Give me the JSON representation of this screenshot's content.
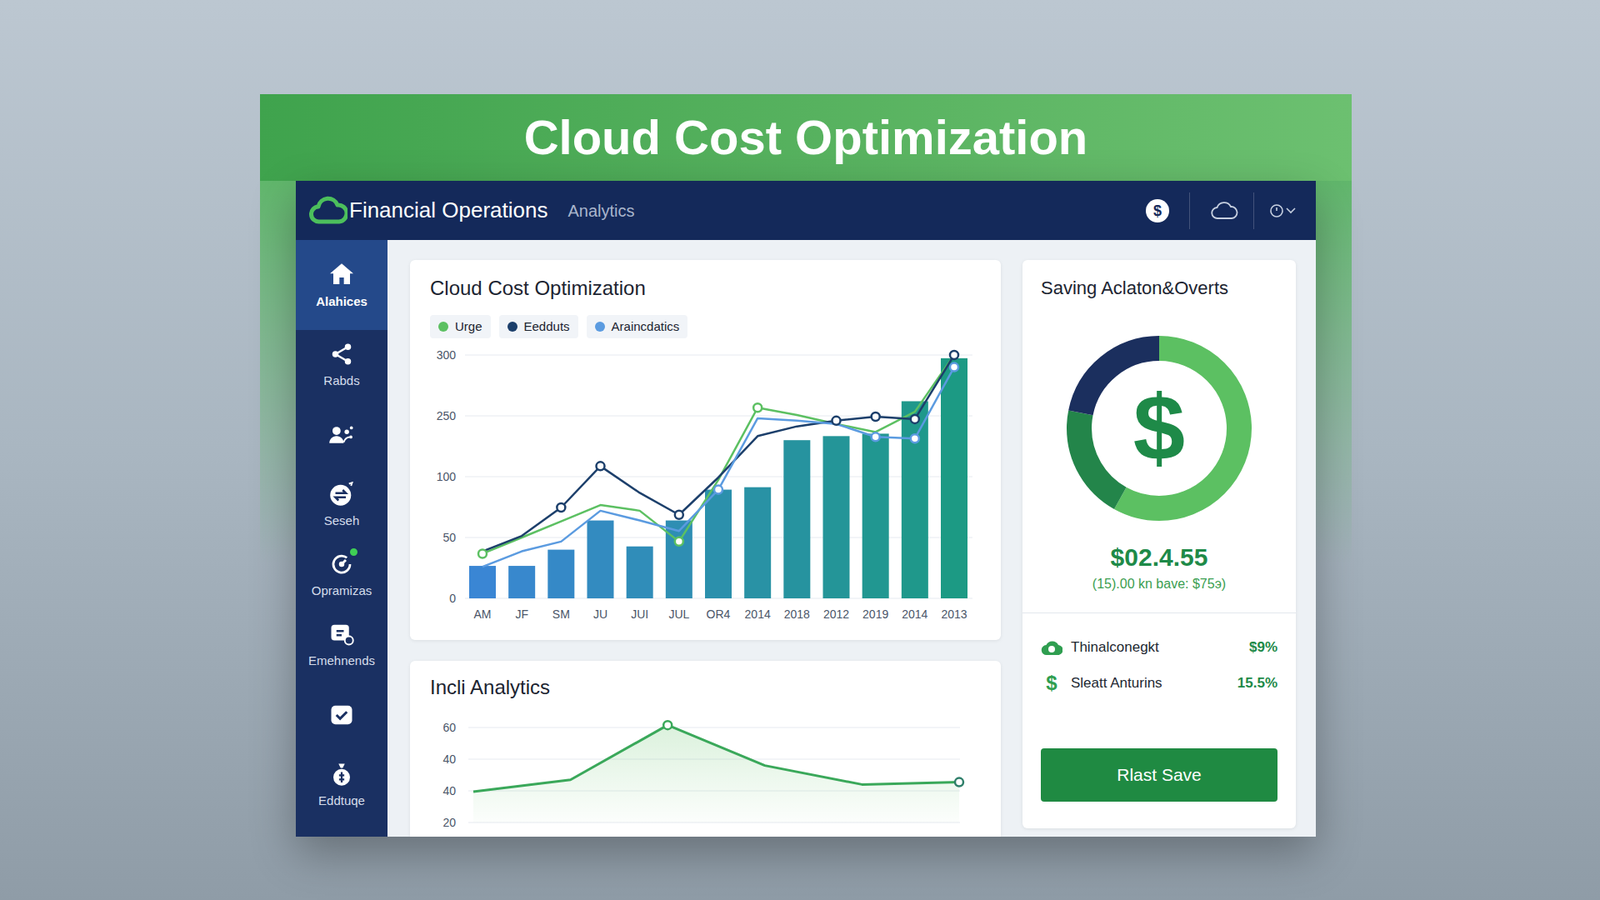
{
  "banner": {
    "title": "Cloud Cost Optimization"
  },
  "header": {
    "app_name": "Financial Operations",
    "section": "Analytics",
    "currency_icon": "$"
  },
  "sidebar": {
    "items": [
      {
        "label": "Alahices",
        "selected": true,
        "badge": false
      },
      {
        "label": "Rabds",
        "selected": false,
        "badge": false
      },
      {
        "selected": false,
        "badge": false
      },
      {
        "label": "Seseh",
        "selected": false,
        "badge": false
      },
      {
        "label": "Opramizas",
        "selected": false,
        "badge": true
      },
      {
        "label": "Emehnends",
        "selected": false,
        "badge": false
      },
      {
        "selected": false,
        "badge": false
      },
      {
        "label": "Eddtuqe",
        "selected": false,
        "badge": false
      }
    ]
  },
  "cost_chart": {
    "title": "Cloud Cost Optimization",
    "y_axis": {
      "max": 300,
      "ticks": [
        "300",
        "250",
        "100",
        "50",
        "0"
      ]
    },
    "x_labels": [
      "AM",
      "JF",
      "SM",
      "JU",
      "JUI",
      "JUL",
      "OR4",
      "2014",
      "2018",
      "2012",
      "2019",
      "2014",
      "2013"
    ],
    "bars": [
      40,
      40,
      60,
      96,
      64,
      96,
      134,
      137,
      195,
      200,
      203,
      243,
      296
    ],
    "series": [
      {
        "label": "Urge",
        "color": "#5cc062",
        "values": [
          55,
          75,
          95,
          115,
          108,
          70,
          146,
          235,
          226,
          215,
          205,
          230,
          300
        ],
        "markers": [
          true,
          false,
          false,
          false,
          false,
          true,
          false,
          true,
          false,
          false,
          false,
          false,
          false
        ]
      },
      {
        "label": "Eedduts",
        "color": "#1c3f6b",
        "values": [
          58,
          77,
          112,
          163,
          130,
          103,
          149,
          200,
          212,
          219,
          224,
          221,
          300
        ],
        "markers": [
          false,
          false,
          true,
          true,
          false,
          true,
          false,
          false,
          false,
          true,
          true,
          true,
          true
        ]
      },
      {
        "label": "Araincdatics",
        "color": "#5b9be0",
        "values": [
          39,
          58,
          70,
          108,
          96,
          83,
          134,
          222,
          219,
          215,
          199,
          197,
          285
        ],
        "markers": [
          false,
          false,
          false,
          false,
          false,
          false,
          true,
          false,
          false,
          false,
          true,
          true,
          true
        ]
      }
    ]
  },
  "usage_chart": {
    "title": "Incli Analytics",
    "y_axis": {
      "min": 20,
      "max": 60,
      "ticks": [
        "60",
        "40",
        "40",
        "20"
      ]
    },
    "values": [
      33,
      38,
      61,
      44,
      36,
      37
    ],
    "markers": [
      false,
      false,
      true,
      false,
      false,
      true
    ]
  },
  "savings": {
    "title": "Saving Aclaton&Overts",
    "icon": "$",
    "segments": [
      {
        "level": 0.58,
        "color": "#5cc062"
      },
      {
        "level": 0.2,
        "color": "#23854a"
      },
      {
        "level": 0.22,
        "color": "#1b2f5e"
      }
    ],
    "amount": "$02.4.55",
    "note": "(15).00 kn bave: $75э)",
    "rows": [
      {
        "label": "Thinalconegkt",
        "value": "$9%"
      },
      {
        "label": "Sleatt Anturins",
        "value": "15.5%",
        "icon": "$"
      }
    ],
    "button": "Rlast Save"
  }
}
